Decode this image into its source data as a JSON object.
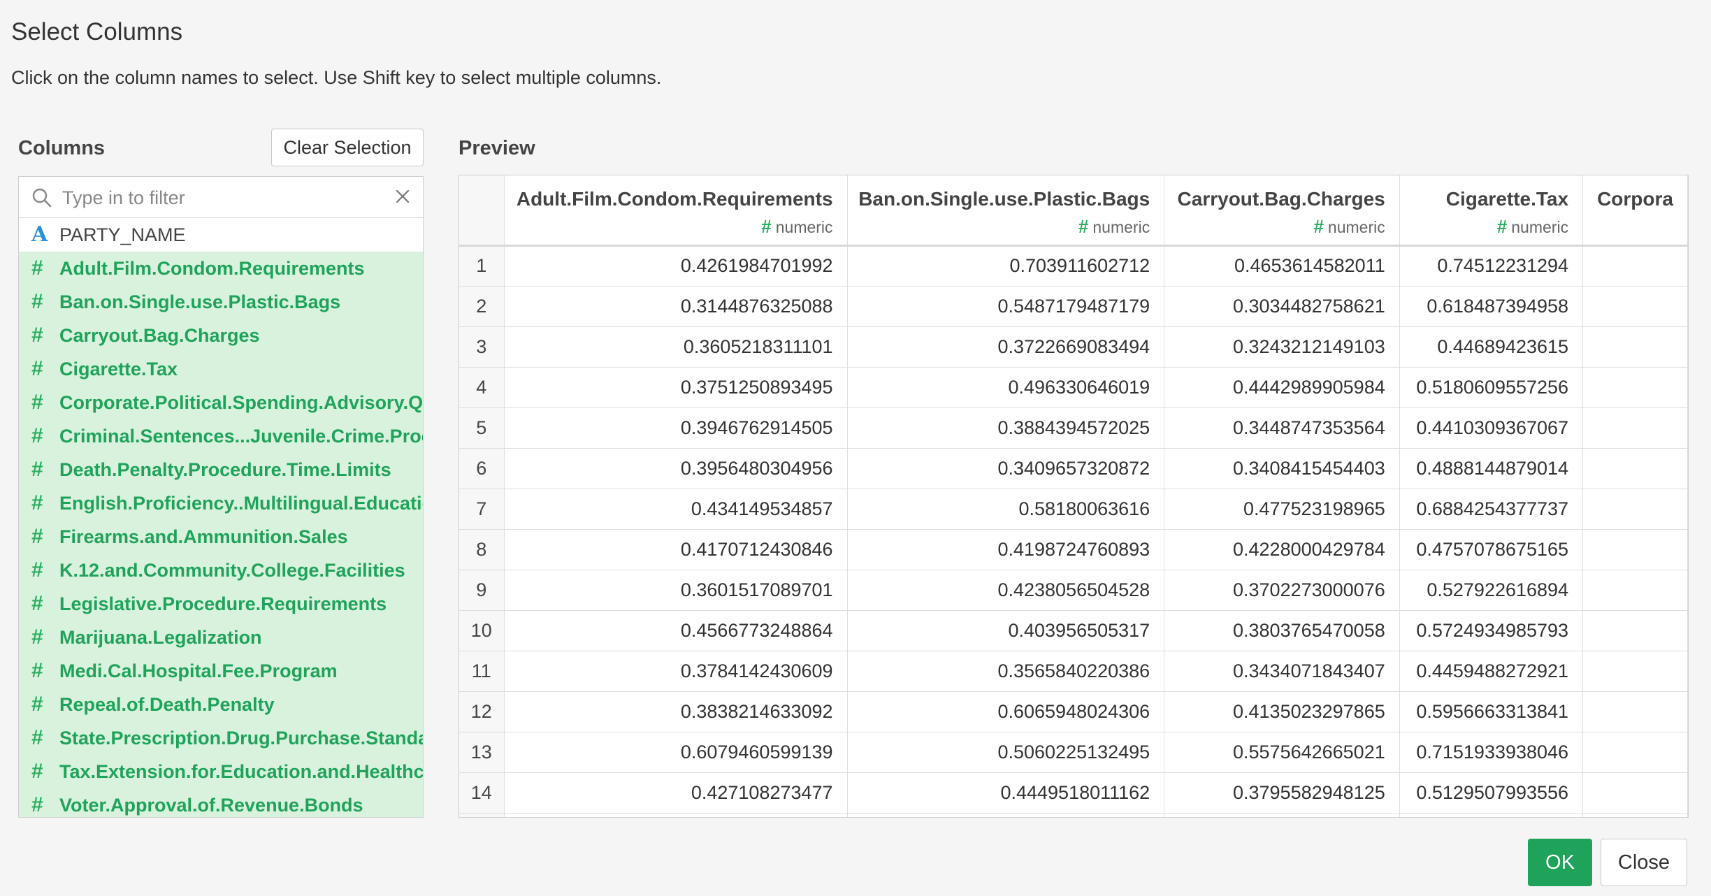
{
  "dialog": {
    "title": "Select Columns",
    "subtitle": "Click on the column names to select. Use Shift key to select multiple columns."
  },
  "columns_pane": {
    "heading": "Columns",
    "clear_label": "Clear Selection",
    "filter_placeholder": "Type in to filter",
    "items": [
      {
        "icon": "A",
        "type": "character",
        "name": "PARTY_NAME",
        "selected": false
      },
      {
        "icon": "#",
        "type": "numeric",
        "name": "Adult.Film.Condom.Requirements",
        "selected": true
      },
      {
        "icon": "#",
        "type": "numeric",
        "name": "Ban.on.Single.use.Plastic.Bags",
        "selected": true
      },
      {
        "icon": "#",
        "type": "numeric",
        "name": "Carryout.Bag.Charges",
        "selected": true
      },
      {
        "icon": "#",
        "type": "numeric",
        "name": "Cigarette.Tax",
        "selected": true
      },
      {
        "icon": "#",
        "type": "numeric",
        "name": "Corporate.Political.Spending.Advisory.Que",
        "selected": true
      },
      {
        "icon": "#",
        "type": "numeric",
        "name": "Criminal.Sentences...Juvenile.Crime.Proce",
        "selected": true
      },
      {
        "icon": "#",
        "type": "numeric",
        "name": "Death.Penalty.Procedure.Time.Limits",
        "selected": true
      },
      {
        "icon": "#",
        "type": "numeric",
        "name": "English.Proficiency..Multilingual.Educatior",
        "selected": true
      },
      {
        "icon": "#",
        "type": "numeric",
        "name": "Firearms.and.Ammunition.Sales",
        "selected": true
      },
      {
        "icon": "#",
        "type": "numeric",
        "name": "K.12.and.Community.College.Facilities",
        "selected": true
      },
      {
        "icon": "#",
        "type": "numeric",
        "name": "Legislative.Procedure.Requirements",
        "selected": true
      },
      {
        "icon": "#",
        "type": "numeric",
        "name": "Marijuana.Legalization",
        "selected": true
      },
      {
        "icon": "#",
        "type": "numeric",
        "name": "Medi.Cal.Hospital.Fee.Program",
        "selected": true
      },
      {
        "icon": "#",
        "type": "numeric",
        "name": "Repeal.of.Death.Penalty",
        "selected": true
      },
      {
        "icon": "#",
        "type": "numeric",
        "name": "State.Prescription.Drug.Purchase.Standar",
        "selected": true
      },
      {
        "icon": "#",
        "type": "numeric",
        "name": "Tax.Extension.for.Education.and.Healthcar",
        "selected": true
      },
      {
        "icon": "#",
        "type": "numeric",
        "name": "Voter.Approval.of.Revenue.Bonds",
        "selected": true
      }
    ]
  },
  "preview": {
    "heading": "Preview",
    "columns": [
      {
        "name": "Adult.Film.Condom.Requirements",
        "type_icon": "#",
        "type": "numeric"
      },
      {
        "name": "Ban.on.Single.use.Plastic.Bags",
        "type_icon": "#",
        "type": "numeric"
      },
      {
        "name": "Carryout.Bag.Charges",
        "type_icon": "#",
        "type": "numeric"
      },
      {
        "name": "Cigarette.Tax",
        "type_icon": "#",
        "type": "numeric"
      },
      {
        "name": "Corpora",
        "type_icon": "",
        "type": ""
      }
    ],
    "rows": [
      {
        "num": "1",
        "cells": [
          "0.4261984701992",
          "0.703911602712",
          "0.4653614582011",
          "0.74512231294",
          ""
        ]
      },
      {
        "num": "2",
        "cells": [
          "0.3144876325088",
          "0.5487179487179",
          "0.3034482758621",
          "0.618487394958",
          ""
        ]
      },
      {
        "num": "3",
        "cells": [
          "0.3605218311101",
          "0.3722669083494",
          "0.3243212149103",
          "0.44689423615",
          ""
        ]
      },
      {
        "num": "4",
        "cells": [
          "0.3751250893495",
          "0.496330646019",
          "0.4442989905984",
          "0.5180609557256",
          ""
        ]
      },
      {
        "num": "5",
        "cells": [
          "0.3946762914505",
          "0.3884394572025",
          "0.3448747353564",
          "0.4410309367067",
          ""
        ]
      },
      {
        "num": "6",
        "cells": [
          "0.3956480304956",
          "0.3409657320872",
          "0.3408415454403",
          "0.4888144879014",
          ""
        ]
      },
      {
        "num": "7",
        "cells": [
          "0.434149534857",
          "0.58180063616",
          "0.477523198965",
          "0.6884254377737",
          ""
        ]
      },
      {
        "num": "8",
        "cells": [
          "0.4170712430846",
          "0.4198724760893",
          "0.4228000429784",
          "0.4757078675165",
          ""
        ]
      },
      {
        "num": "9",
        "cells": [
          "0.3601517089701",
          "0.4238056504528",
          "0.3702273000076",
          "0.527922616894",
          ""
        ]
      },
      {
        "num": "10",
        "cells": [
          "0.4566773248864",
          "0.403956505317",
          "0.3803765470058",
          "0.5724934985793",
          ""
        ]
      },
      {
        "num": "11",
        "cells": [
          "0.3784142430609",
          "0.3565840220386",
          "0.3434071843407",
          "0.4459488272921",
          ""
        ]
      },
      {
        "num": "12",
        "cells": [
          "0.3838214633092",
          "0.6065948024306",
          "0.4135023297865",
          "0.5956663313841",
          ""
        ]
      },
      {
        "num": "13",
        "cells": [
          "0.6079460599139",
          "0.5060225132495",
          "0.5575642665021",
          "0.7151933938046",
          ""
        ]
      },
      {
        "num": "14",
        "cells": [
          "0.427108273477",
          "0.4449518011162",
          "0.3795582948125",
          "0.5129507993556",
          ""
        ]
      }
    ]
  },
  "footer": {
    "ok_label": "OK",
    "close_label": "Close"
  },
  "colors": {
    "selected_bg": "#d9f2de",
    "selected_text": "#1fa35a",
    "char_icon": "#2a8fd6",
    "ok_bg": "#1fa35a"
  }
}
